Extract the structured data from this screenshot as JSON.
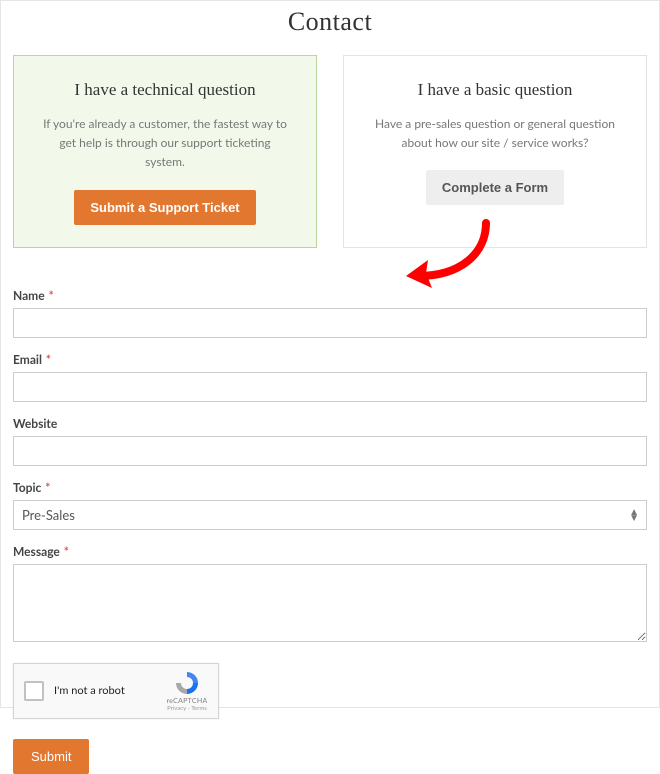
{
  "page_title": "Contact",
  "cards": {
    "technical": {
      "title": "I have a technical question",
      "desc": "If you're already a customer, the fastest way to get help is through our support ticketing system.",
      "button": "Submit a Support Ticket"
    },
    "basic": {
      "title": "I have a basic question",
      "desc": "Have a pre-sales question or general question about how our site / service works?",
      "button": "Complete a Form"
    }
  },
  "form": {
    "name_label": "Name",
    "email_label": "Email",
    "website_label": "Website",
    "topic_label": "Topic",
    "topic_value": "Pre-Sales",
    "message_label": "Message",
    "submit": "Submit"
  },
  "recaptcha": {
    "text": "I'm not a robot",
    "brand": "reCAPTCHA",
    "links": "Privacy - Terms"
  },
  "required_mark": "*"
}
